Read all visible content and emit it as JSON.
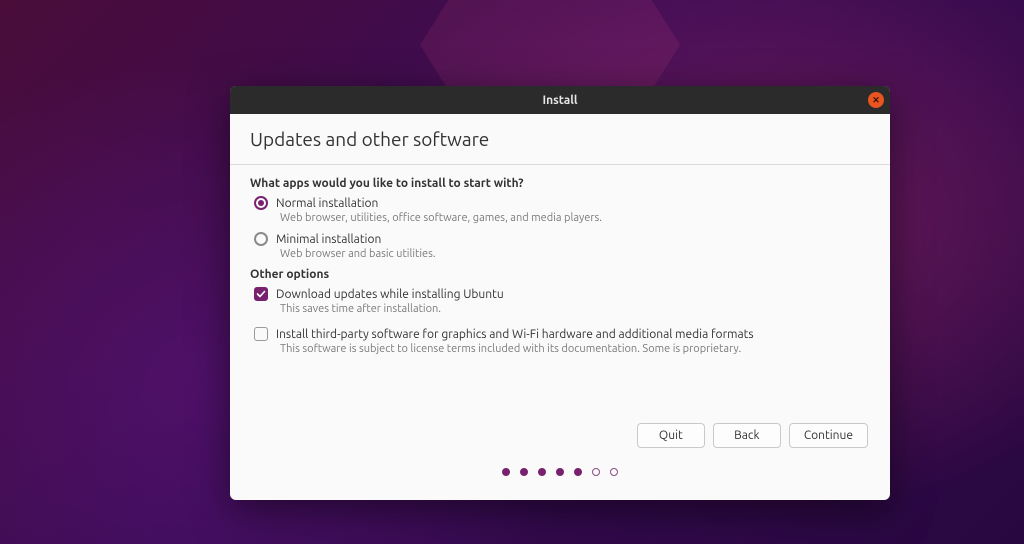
{
  "window": {
    "title": "Install"
  },
  "page": {
    "heading": "Updates and other software",
    "apps_question": "What apps would you like to install to start with?",
    "normal": {
      "label": "Normal installation",
      "desc": "Web browser, utilities, office software, games, and media players.",
      "selected": true
    },
    "minimal": {
      "label": "Minimal installation",
      "desc": "Web browser and basic utilities.",
      "selected": false
    },
    "other_heading": "Other options",
    "download_updates": {
      "label": "Download updates while installing Ubuntu",
      "desc": "This saves time after installation.",
      "checked": true
    },
    "third_party": {
      "label": "Install third-party software for graphics and Wi-Fi hardware and additional media formats",
      "desc": "This software is subject to license terms included with its documentation. Some is proprietary.",
      "checked": false
    }
  },
  "buttons": {
    "quit": "Quit",
    "back": "Back",
    "continue": "Continue"
  },
  "progress": {
    "total": 7,
    "current": 5
  }
}
